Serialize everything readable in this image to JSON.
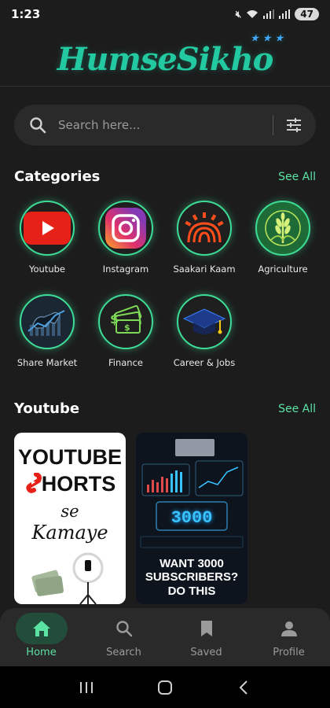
{
  "status_bar": {
    "time": "1:23",
    "battery": "47"
  },
  "app": {
    "logo_text": "HumseSikho",
    "logo_stars": "★ ★ ★"
  },
  "search": {
    "placeholder": "Search here..."
  },
  "categories": {
    "title": "Categories",
    "see_all": "See All",
    "items": [
      {
        "label": "Youtube",
        "icon": "youtube-icon"
      },
      {
        "label": "Instagram",
        "icon": "instagram-icon"
      },
      {
        "label": "Saakari Kaam",
        "icon": "aadhaar-icon"
      },
      {
        "label": "Agriculture",
        "icon": "wheat-icon"
      },
      {
        "label": "Share Market",
        "icon": "bull-chart-icon"
      },
      {
        "label": "Finance",
        "icon": "money-icon"
      },
      {
        "label": "Career & Jobs",
        "icon": "graduation-cap-icon"
      }
    ]
  },
  "youtube_section": {
    "title": "Youtube",
    "see_all": "See All",
    "cards": [
      {
        "line1": "YOUTUBE",
        "line2_rest": "HORTS",
        "line3": "se",
        "line4": "Kamaye"
      },
      {
        "big_number": "3000",
        "text": "WANT 3000 SUBSCRIBERS? DO THIS"
      }
    ]
  },
  "bottom_nav": {
    "items": [
      {
        "label": "Home",
        "icon": "home-icon",
        "active": true
      },
      {
        "label": "Search",
        "icon": "search-icon",
        "active": false
      },
      {
        "label": "Saved",
        "icon": "bookmark-icon",
        "active": false
      },
      {
        "label": "Profile",
        "icon": "profile-icon",
        "active": false
      }
    ]
  },
  "colors": {
    "accent": "#5be3a4",
    "ring": "#3ddc97",
    "background": "#1c1c1c",
    "surface": "#2a2a2a"
  }
}
